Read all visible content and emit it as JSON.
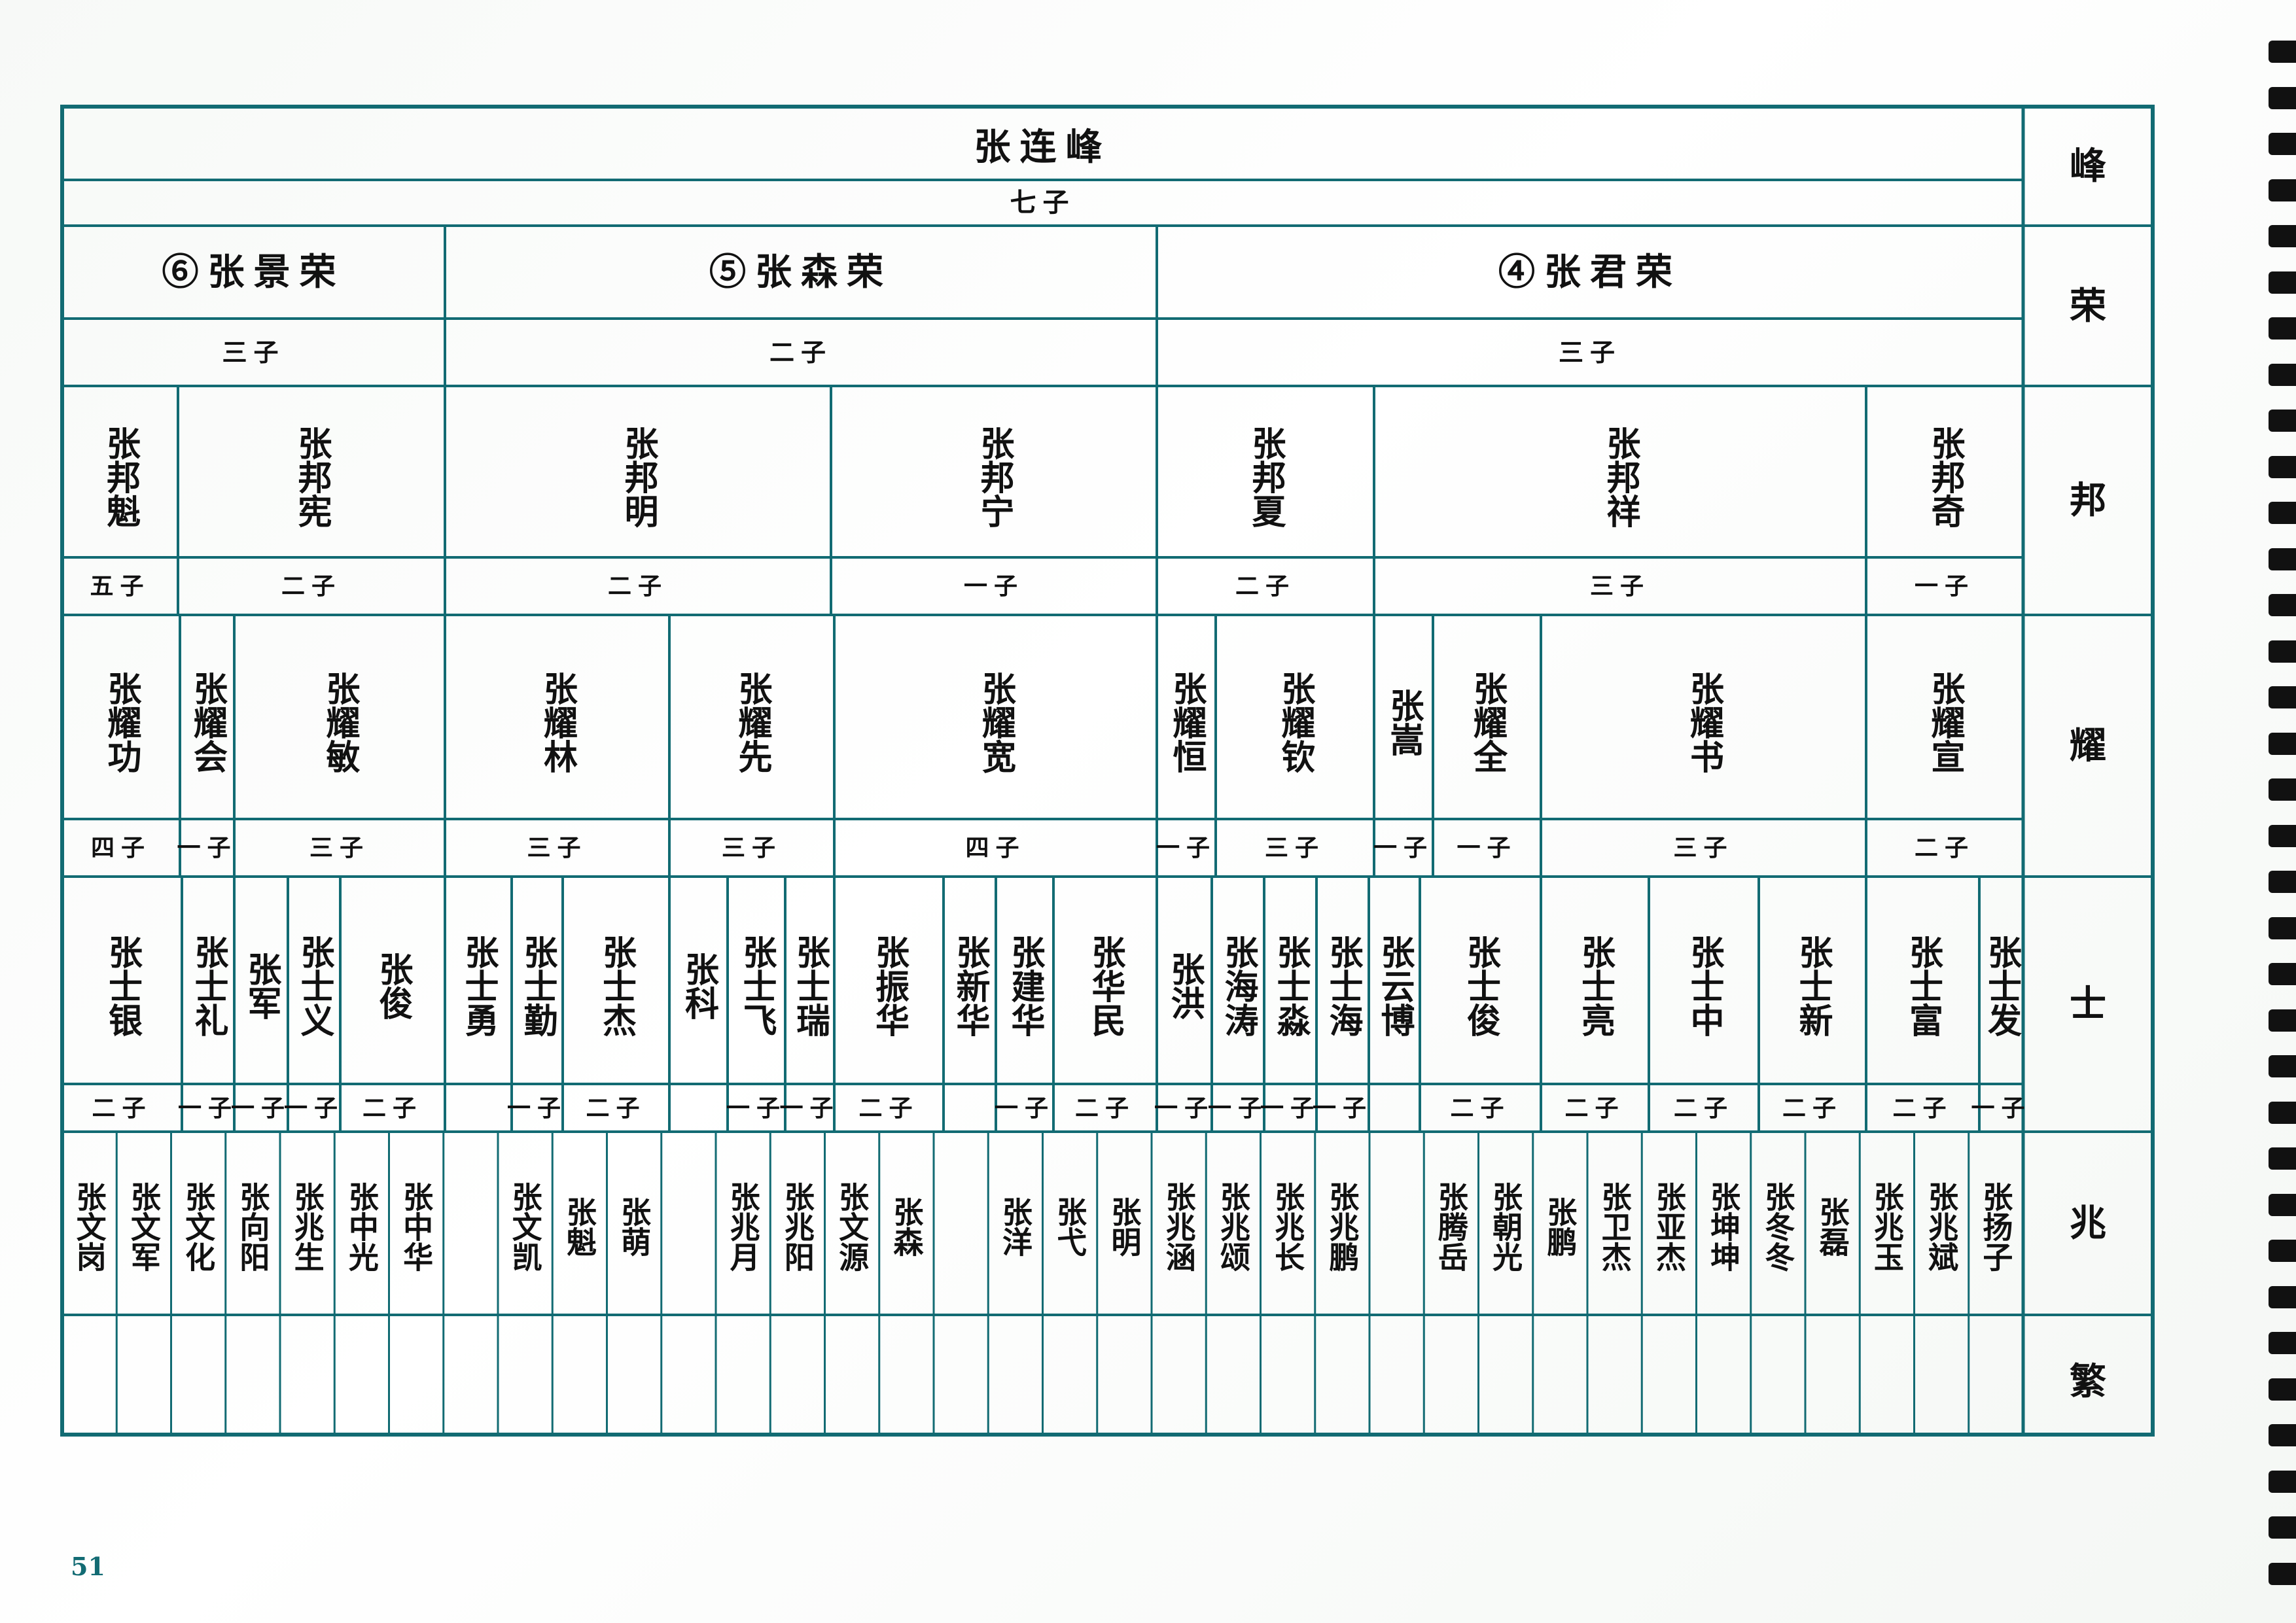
{
  "page": {
    "number": "51"
  },
  "generations": [
    "峰",
    "荣",
    "邦",
    "耀",
    "士",
    "兆",
    "繁"
  ],
  "row0": {
    "name": "张连峰",
    "children": "七子"
  },
  "row1": [
    {
      "name": "⑥张景荣",
      "children": "三子"
    },
    {
      "name": "⑤张森荣",
      "children": "二子"
    },
    {
      "name": "④张君荣",
      "children": "三子"
    }
  ],
  "row2": [
    {
      "name": "张邦魁",
      "children": "五子"
    },
    {
      "name": "张邦宪",
      "children": "二子"
    },
    {
      "name": "张邦明",
      "children": "二子"
    },
    {
      "name": "张邦宁",
      "children": "一子"
    },
    {
      "name": "张邦夏",
      "children": "二子"
    },
    {
      "name": "张邦祥",
      "children": "三子"
    },
    {
      "name": "张邦奇",
      "children": "一子"
    }
  ],
  "row3": [
    {
      "name": "张耀功",
      "children": "四子"
    },
    {
      "name": "张耀会",
      "children": "一子"
    },
    {
      "name": "张耀敏",
      "children": "三子"
    },
    {
      "name": "张耀林",
      "children": "三子"
    },
    {
      "name": "张耀先",
      "children": "三子"
    },
    {
      "name": "张耀宽",
      "children": "四子"
    },
    {
      "name": "张耀恒",
      "children": "一子"
    },
    {
      "name": "张耀钦",
      "children": "三子"
    },
    {
      "name": "张嵩",
      "children": "一子"
    },
    {
      "name": "张耀全",
      "children": "一子"
    },
    {
      "name": "张耀书",
      "children": "三子"
    },
    {
      "name": "张耀宣",
      "children": "二子"
    }
  ],
  "row4": [
    {
      "name": "张士银",
      "children": "二子"
    },
    {
      "name": "张士礼",
      "children": "一子"
    },
    {
      "name": "张军",
      "children": "一子"
    },
    {
      "name": "张士义",
      "children": "一子"
    },
    {
      "name": "张俊",
      "children": "二子"
    },
    {
      "name": "张士勇",
      "children": ""
    },
    {
      "name": "张士勤",
      "children": "一子"
    },
    {
      "name": "张士杰",
      "children": "二子"
    },
    {
      "name": "张科",
      "children": ""
    },
    {
      "name": "张士飞",
      "children": "一子"
    },
    {
      "name": "张士瑞",
      "children": "一子"
    },
    {
      "name": "张振华",
      "children": "二子"
    },
    {
      "name": "张新华",
      "children": ""
    },
    {
      "name": "张建华",
      "children": "一子"
    },
    {
      "name": "张华民",
      "children": "二子"
    },
    {
      "name": "张洪",
      "children": "一子"
    },
    {
      "name": "张海涛",
      "children": "一子"
    },
    {
      "name": "张士淼",
      "children": "一子"
    },
    {
      "name": "张士海",
      "children": "一子"
    },
    {
      "name": "张云博",
      "children": ""
    },
    {
      "name": "张士俊",
      "children": "二子"
    },
    {
      "name": "张士亮",
      "children": "二子"
    },
    {
      "name": "张士中",
      "children": "二子"
    },
    {
      "name": "张士新",
      "children": "二子"
    },
    {
      "name": "张士富",
      "children": "二子"
    },
    {
      "name": "张士发",
      "children": "一子"
    }
  ],
  "row5": [
    "张文岗",
    "张文军",
    "张文化",
    "张向阳",
    "张兆生",
    "张中光",
    "张中华",
    "",
    "张文凯",
    "张魁",
    "张萌",
    "",
    "张兆月",
    "张兆阳",
    "张文源",
    "张森",
    "",
    "张洋",
    "张弋",
    "张明",
    "张兆涵",
    "张兆颂",
    "张兆长",
    "张兆鹏",
    "",
    "张腾岳",
    "张朝光",
    "张鹏",
    "张卫杰",
    "张亚杰",
    "张坤坤",
    "张冬冬",
    "张磊",
    "张兆玉",
    "张兆斌",
    "张扬子"
  ],
  "colors": {
    "line": "#126b73",
    "text": "#111111"
  }
}
